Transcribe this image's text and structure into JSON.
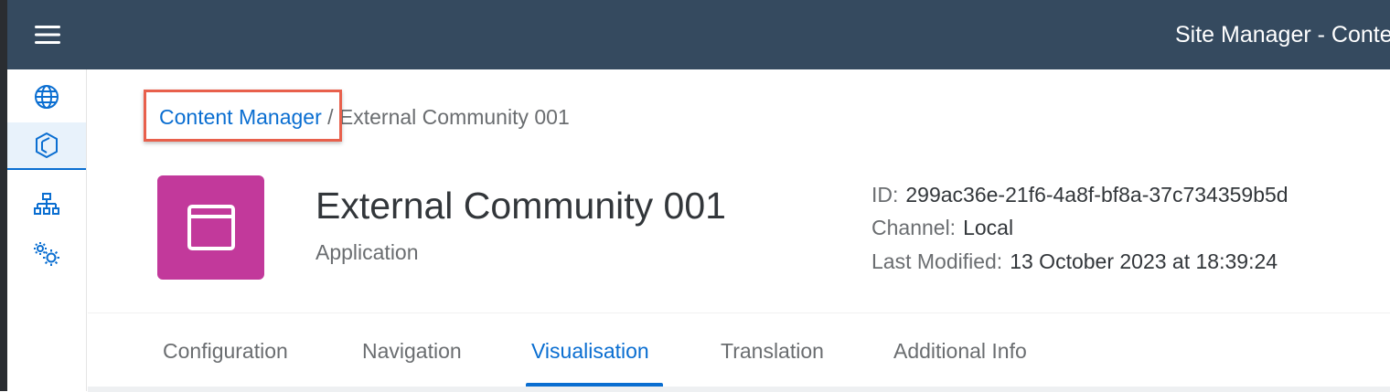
{
  "shell": {
    "title": "Site Manager - Conte",
    "menu_icon": "hamburger-menu-icon",
    "background": "#354a5f"
  },
  "side_nav": {
    "items": [
      {
        "id": "sites",
        "icon": "globe-icon",
        "selected": false
      },
      {
        "id": "content-manager",
        "icon": "cube-icon",
        "selected": true
      },
      {
        "id": "channel-manager",
        "icon": "hierarchy-icon",
        "selected": false
      },
      {
        "id": "settings",
        "icon": "gears-icon",
        "selected": false
      }
    ]
  },
  "breadcrumb": {
    "link": "Content Manager",
    "separator": "/",
    "current": "External Community 001"
  },
  "object": {
    "icon": "app-window-icon",
    "tile_color": "#c2399b",
    "title": "External Community 001",
    "subtitle": "Application"
  },
  "attributes": {
    "id_label": "ID:",
    "id_value": "299ac36e-21f6-4a8f-bf8a-37c734359b5d",
    "channel_label": "Channel:",
    "channel_value": "Local",
    "modified_label": "Last Modified:",
    "modified_value": "13 October 2023 at 18:39:24"
  },
  "tabs": [
    {
      "label": "Configuration",
      "active": false
    },
    {
      "label": "Navigation",
      "active": false
    },
    {
      "label": "Visualisation",
      "active": true
    },
    {
      "label": "Translation",
      "active": false
    },
    {
      "label": "Additional Info",
      "active": false
    }
  ],
  "colors": {
    "accent": "#0a6ed1",
    "highlight": "#e8604c"
  }
}
